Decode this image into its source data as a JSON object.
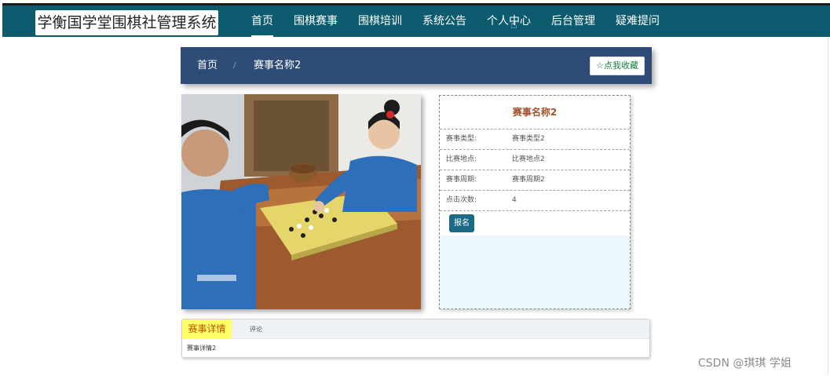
{
  "header": {
    "logo_text": "学衡国学堂围棋社管理系统",
    "nav": [
      {
        "label": "首页",
        "active": true
      },
      {
        "label": "围棋赛事",
        "active": false
      },
      {
        "label": "围棋培训",
        "active": false
      },
      {
        "label": "系统公告",
        "active": false
      },
      {
        "label": "个人中心",
        "active": false
      },
      {
        "label": "后台管理",
        "active": false
      },
      {
        "label": "疑难提问",
        "active": false
      }
    ],
    "bg_color": "#0d5b6e"
  },
  "breadcrumb": {
    "home": "首页",
    "separator": "/",
    "current": "赛事名称2",
    "favorite_label": "☆点我收藏"
  },
  "detail": {
    "title": "赛事名称2",
    "rows": [
      {
        "label": "赛事类型:",
        "value": "赛事类型2"
      },
      {
        "label": "比赛地点:",
        "value": "比赛地点2"
      },
      {
        "label": "赛事周期:",
        "value": "赛事周期2"
      },
      {
        "label": "点击次数:",
        "value": "4"
      }
    ],
    "apply_label": "报名"
  },
  "tabs": {
    "items": [
      {
        "label": "赛事详情",
        "active": true
      },
      {
        "label": "评论",
        "active": false
      }
    ],
    "content": "赛事详情2"
  },
  "watermark": "CSDN @琪琪 学姐"
}
